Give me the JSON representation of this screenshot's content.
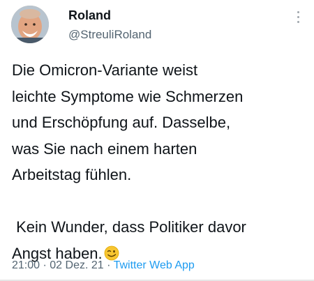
{
  "tweet": {
    "author_name": "Roland",
    "handle": "@StreuliRoland",
    "lines": [
      "Die Omicron-Variante weist",
      "leichte Symptome wie Schmerzen",
      "und Erschöpfung auf. Dasselbe,",
      "was Sie nach einem harten",
      "Arbeitstag fühlen."
    ],
    "lines2": [
      " Kein Wunder, dass Politiker davor",
      "Angst haben."
    ],
    "emoji": "winking-face-emoji",
    "time": "21:00",
    "separator": "·",
    "date": "02 Dez. 21",
    "source": "Twitter Web App"
  },
  "colors": {
    "text": "#0f1419",
    "secondary": "#536471",
    "link": "#1d9bf0"
  }
}
